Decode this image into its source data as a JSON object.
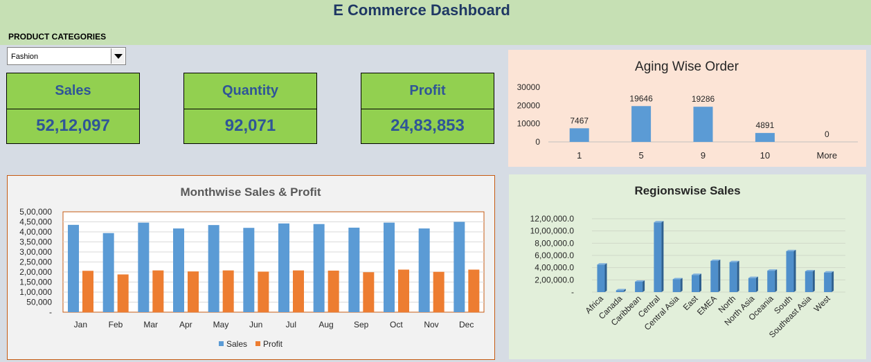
{
  "header": {
    "title": "E Commerce Dashboard"
  },
  "filter": {
    "label": "PRODUCT CATEGORIES",
    "selected": "Fashion"
  },
  "kpis": [
    {
      "label": "Sales",
      "value": "52,12,097"
    },
    {
      "label": "Quantity",
      "value": "92,071"
    },
    {
      "label": "Profit",
      "value": "24,83,853"
    }
  ],
  "colors": {
    "header_bg": "#c6e0b4",
    "kpi_bg": "#92d050",
    "kpi_text": "#2f5597",
    "sales": "#5b9bd5",
    "profit": "#ed7d31"
  },
  "chart_data": [
    {
      "type": "bar",
      "title": "Aging Wise Order",
      "categories": [
        "1",
        "5",
        "9",
        "10",
        "More"
      ],
      "values": [
        7467,
        19646,
        19286,
        4891,
        0
      ],
      "data_labels": [
        "7467",
        "19646",
        "19286",
        "4891",
        "0"
      ],
      "ylim": [
        0,
        30000
      ],
      "yticks": [
        "0",
        "10000",
        "20000",
        "30000"
      ],
      "grid": false
    },
    {
      "type": "bar",
      "title": "Monthwise Sales & Profit",
      "categories": [
        "Jan",
        "Feb",
        "Mar",
        "Apr",
        "May",
        "Jun",
        "Jul",
        "Aug",
        "Sep",
        "Oct",
        "Nov",
        "Dec"
      ],
      "series": [
        {
          "name": "Sales",
          "values": [
            435000,
            394000,
            446000,
            417000,
            434000,
            420000,
            442000,
            439000,
            421000,
            446000,
            417000,
            450000
          ]
        },
        {
          "name": "Profit",
          "values": [
            206000,
            188000,
            208000,
            203000,
            208000,
            202000,
            208000,
            207000,
            199000,
            212000,
            201000,
            212000
          ]
        }
      ],
      "ylim": [
        0,
        500000
      ],
      "yticks": [
        "-",
        "50,000",
        "1,00,000",
        "1,50,000",
        "2,00,000",
        "2,50,000",
        "3,00,000",
        "3,50,000",
        "4,00,000",
        "4,50,000",
        "5,00,000"
      ],
      "legend": "bottom",
      "grid": true
    },
    {
      "type": "bar",
      "title": "Regionswise Sales",
      "categories": [
        "Africa",
        "Canada",
        "Caribbean",
        "Central",
        "Central Asia",
        "East",
        "EMEA",
        "North",
        "North Asia",
        "Oceania",
        "South",
        "Southeast Asia",
        "West"
      ],
      "values": [
        450000,
        30000,
        170000,
        1140000,
        210000,
        280000,
        510000,
        490000,
        230000,
        350000,
        670000,
        340000,
        320000
      ],
      "ylim": [
        0,
        1200000
      ],
      "yticks": [
        "-",
        "2,00,000.0",
        "4,00,000.0",
        "6,00,000.0",
        "8,00,000.0",
        "10,00,000.0",
        "12,00,000.0"
      ],
      "grid": true
    }
  ]
}
